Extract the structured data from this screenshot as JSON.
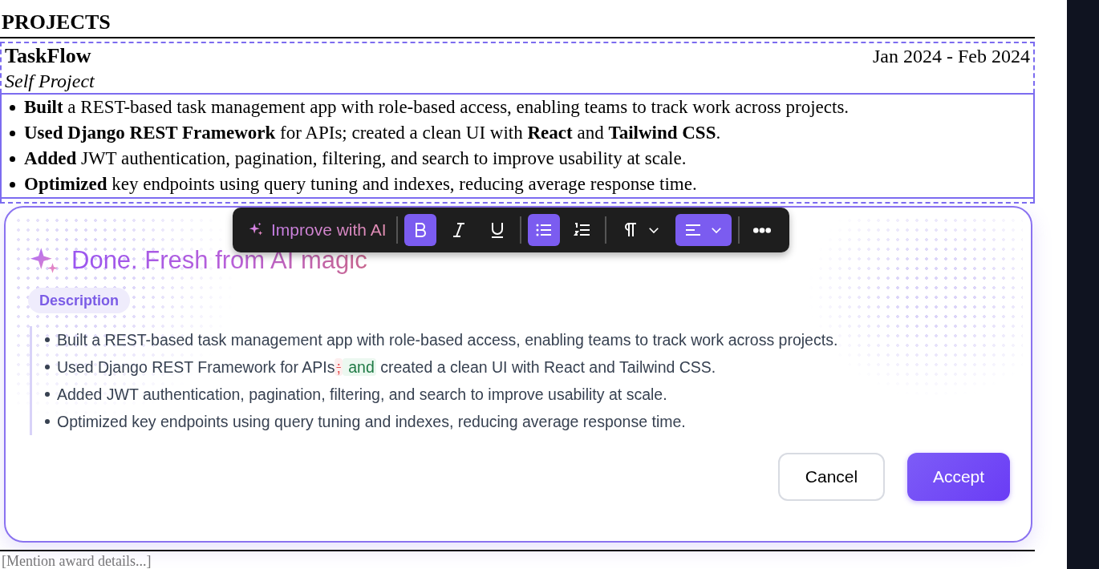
{
  "section": {
    "title": "PROJECTS",
    "project": {
      "name": "TaskFlow",
      "date": "Jan 2024 - Feb 2024",
      "role": "Self Project",
      "bullets": [
        "**Built** a REST-based task management app with role-based access, enabling teams to track work across projects.",
        "**Used Django REST Framework** for APIs; created a clean UI with **React** and **Tailwind CSS**.",
        "**Added** JWT authentication, pagination, filtering, and search to improve usability at scale.",
        "**Optimized** key endpoints using query tuning and indexes, reducing average response time."
      ]
    }
  },
  "award_placeholder": "[Mention award details...]",
  "toolbar": {
    "ai_label": "Improve with AI",
    "buttons": [
      {
        "kind": "bold",
        "selected": true
      },
      {
        "kind": "italic",
        "selected": false
      },
      {
        "kind": "underline",
        "selected": false
      },
      {
        "kind": "bullet_list",
        "selected": true
      },
      {
        "kind": "numbered_list",
        "selected": false
      },
      {
        "kind": "paragraph",
        "selected": false
      },
      {
        "kind": "align_left",
        "selected": true
      },
      {
        "kind": "more",
        "selected": false
      }
    ]
  },
  "dialog": {
    "title": "Done. Fresh from AI magic",
    "tag": "Description",
    "bullets": [
      {
        "segments": [
          {
            "kind": "plain",
            "text": "Built a REST-based task management app with role-based access, enabling teams to track work across projects."
          }
        ]
      },
      {
        "segments": [
          {
            "kind": "plain",
            "text": "Used Django REST Framework for APIs"
          },
          {
            "kind": "removed",
            "text": ";"
          },
          {
            "kind": "added",
            "text": " and"
          },
          {
            "kind": "plain",
            "text": " created a clean UI with React and Tailwind CSS."
          }
        ]
      },
      {
        "segments": [
          {
            "kind": "plain",
            "text": "Added JWT authentication, pagination, filtering, and search to improve usability at scale."
          }
        ]
      },
      {
        "segments": [
          {
            "kind": "plain",
            "text": "Optimized key endpoints using query tuning and indexes, reducing average response time."
          }
        ]
      }
    ],
    "buttons": [
      {
        "label": "Cancel",
        "kind": "secondary"
      },
      {
        "label": "Accept",
        "kind": "primary"
      }
    ]
  }
}
